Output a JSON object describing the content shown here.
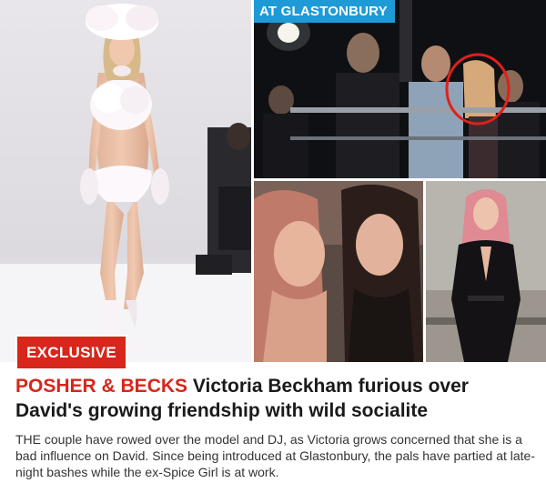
{
  "photo_labels": {
    "glastonbury": "AT GLASTONBURY"
  },
  "badge": {
    "exclusive": "EXCLUSIVE"
  },
  "article": {
    "kicker": "POSHER & BECKS",
    "headline": "Victoria Beckham furious over David's growing friendship with wild socialite",
    "standfirst": "THE couple have rowed over the model and DJ, as Victoria grows concerned that she is a bad influence on David. Since being introduced at Glastonbury, the pals have partied at late-night bashes while the ex-Spice Girl is at work."
  },
  "colors": {
    "accent_red": "#d7261b",
    "label_blue": "#1e9ad6",
    "headline": "#1a1a1a",
    "body": "#333333"
  },
  "icons": [
    "circle-highlight"
  ]
}
